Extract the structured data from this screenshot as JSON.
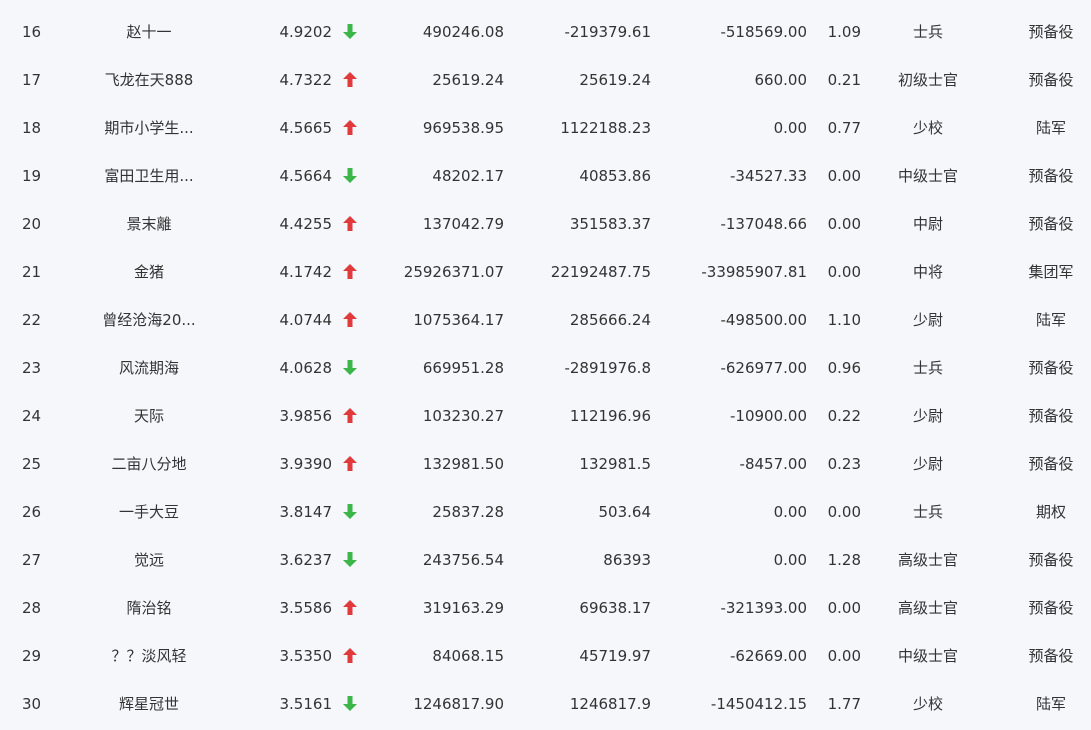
{
  "colors": {
    "up": "#e03a3a",
    "down": "#3cb54a",
    "text": "#333333",
    "background": "#f5f7fa"
  },
  "rows": [
    {
      "rank": "16",
      "name": "赵十一",
      "score": "4.9202",
      "trend": "down",
      "v1": "490246.08",
      "v2": "-219379.61",
      "v3": "-518569.00",
      "ratio": "1.09",
      "title": "士兵",
      "unit": "预备役"
    },
    {
      "rank": "17",
      "name": "飞龙在天888",
      "score": "4.7322",
      "trend": "up",
      "v1": "25619.24",
      "v2": "25619.24",
      "v3": "660.00",
      "ratio": "0.21",
      "title": "初级士官",
      "unit": "预备役"
    },
    {
      "rank": "18",
      "name": "期市小学生...",
      "score": "4.5665",
      "trend": "up",
      "v1": "969538.95",
      "v2": "1122188.23",
      "v3": "0.00",
      "ratio": "0.77",
      "title": "少校",
      "unit": "陆军"
    },
    {
      "rank": "19",
      "name": "富田卫生用...",
      "score": "4.5664",
      "trend": "down",
      "v1": "48202.17",
      "v2": "40853.86",
      "v3": "-34527.33",
      "ratio": "0.00",
      "title": "中级士官",
      "unit": "预备役"
    },
    {
      "rank": "20",
      "name": "景末離",
      "score": "4.4255",
      "trend": "up",
      "v1": "137042.79",
      "v2": "351583.37",
      "v3": "-137048.66",
      "ratio": "0.00",
      "title": "中尉",
      "unit": "预备役"
    },
    {
      "rank": "21",
      "name": "金猪",
      "score": "4.1742",
      "trend": "up",
      "v1": "25926371.07",
      "v2": "22192487.75",
      "v3": "-33985907.81",
      "ratio": "0.00",
      "title": "中将",
      "unit": "集团军"
    },
    {
      "rank": "22",
      "name": "曾经沧海20...",
      "score": "4.0744",
      "trend": "up",
      "v1": "1075364.17",
      "v2": "285666.24",
      "v3": "-498500.00",
      "ratio": "1.10",
      "title": "少尉",
      "unit": "陆军"
    },
    {
      "rank": "23",
      "name": "风流期海",
      "score": "4.0628",
      "trend": "down",
      "v1": "669951.28",
      "v2": "-2891976.8",
      "v3": "-626977.00",
      "ratio": "0.96",
      "title": "士兵",
      "unit": "预备役"
    },
    {
      "rank": "24",
      "name": "天际",
      "score": "3.9856",
      "trend": "up",
      "v1": "103230.27",
      "v2": "112196.96",
      "v3": "-10900.00",
      "ratio": "0.22",
      "title": "少尉",
      "unit": "预备役"
    },
    {
      "rank": "25",
      "name": "二亩八分地",
      "score": "3.9390",
      "trend": "up",
      "v1": "132981.50",
      "v2": "132981.5",
      "v3": "-8457.00",
      "ratio": "0.23",
      "title": "少尉",
      "unit": "预备役"
    },
    {
      "rank": "26",
      "name": "一手大豆",
      "score": "3.8147",
      "trend": "down",
      "v1": "25837.28",
      "v2": "503.64",
      "v3": "0.00",
      "ratio": "0.00",
      "title": "士兵",
      "unit": "期权"
    },
    {
      "rank": "27",
      "name": "觉远",
      "score": "3.6237",
      "trend": "down",
      "v1": "243756.54",
      "v2": "86393",
      "v3": "0.00",
      "ratio": "1.28",
      "title": "高级士官",
      "unit": "预备役"
    },
    {
      "rank": "28",
      "name": "隋治铭",
      "score": "3.5586",
      "trend": "up",
      "v1": "319163.29",
      "v2": "69638.17",
      "v3": "-321393.00",
      "ratio": "0.00",
      "title": "高级士官",
      "unit": "预备役"
    },
    {
      "rank": "29",
      "name": "？？淡风轻",
      "score": "3.5350",
      "trend": "up",
      "v1": "84068.15",
      "v2": "45719.97",
      "v3": "-62669.00",
      "ratio": "0.00",
      "title": "中级士官",
      "unit": "预备役"
    },
    {
      "rank": "30",
      "name": "辉星冠世",
      "score": "3.5161",
      "trend": "down",
      "v1": "1246817.90",
      "v2": "1246817.9",
      "v3": "-1450412.15",
      "ratio": "1.77",
      "title": "少校",
      "unit": "陆军"
    }
  ]
}
